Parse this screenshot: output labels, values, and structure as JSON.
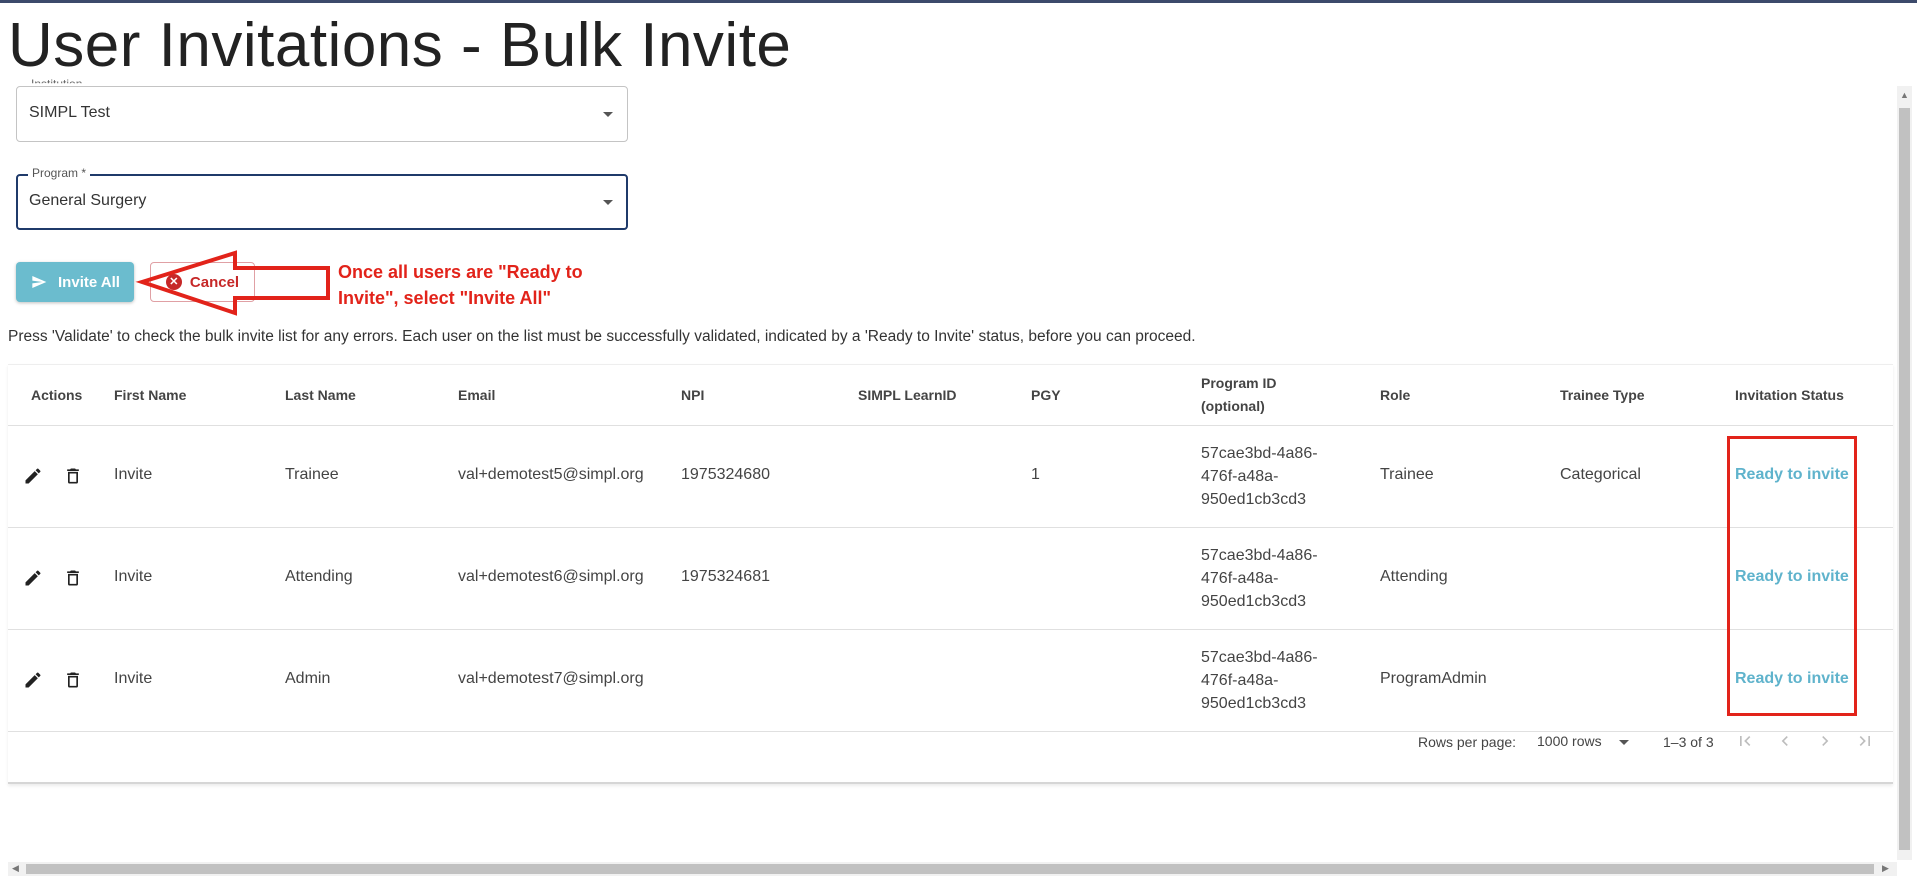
{
  "page": {
    "title": "User Invitations - Bulk Invite"
  },
  "form": {
    "institution": {
      "label": "Institution",
      "value": "SIMPL Test"
    },
    "program": {
      "label": "Program *",
      "value": "General Surgery"
    }
  },
  "buttons": {
    "invite_all": "Invite All",
    "cancel": "Cancel"
  },
  "annotation": {
    "text": "Once all users are \"Ready to Invite\", select \"Invite All\"",
    "color": "#e2231a"
  },
  "hint": "Press 'Validate' to check the bulk invite list for any errors. Each user on the list must be successfully validated, indicated by a 'Ready to Invite' status, before you can proceed.",
  "table": {
    "columns": {
      "actions": "Actions",
      "first_name": "First Name",
      "last_name": "Last Name",
      "email": "Email",
      "npi": "NPI",
      "learn_id": "SIMPL LearnID",
      "pgy": "PGY",
      "program_id_1": "Program ID",
      "program_id_2": "(optional)",
      "role": "Role",
      "trainee_type": "Trainee Type",
      "status": "Invitation Status"
    },
    "rows": [
      {
        "first": "Invite",
        "last": "Trainee",
        "email": "val+demotest5@simpl.org",
        "npi": "1975324680",
        "learn_id": "",
        "pgy": "1",
        "pid1": "57cae3bd-4a86-",
        "pid2": "476f-a48a-",
        "pid3": "950ed1cb3cd3",
        "role": "Trainee",
        "trainee_type": "Categorical",
        "status": "Ready to invite"
      },
      {
        "first": "Invite",
        "last": "Attending",
        "email": "val+demotest6@simpl.org",
        "npi": "1975324681",
        "learn_id": "",
        "pgy": "",
        "pid1": "57cae3bd-4a86-",
        "pid2": "476f-a48a-",
        "pid3": "950ed1cb3cd3",
        "role": "Attending",
        "trainee_type": "",
        "status": "Ready to invite"
      },
      {
        "first": "Invite",
        "last": "Admin",
        "email": "val+demotest7@simpl.org",
        "npi": "",
        "learn_id": "",
        "pgy": "",
        "pid1": "57cae3bd-4a86-",
        "pid2": "476f-a48a-",
        "pid3": "950ed1cb3cd3",
        "role": "ProgramAdmin",
        "trainee_type": "",
        "status": "Ready to invite"
      }
    ]
  },
  "pagination": {
    "rows_per_page_label": "Rows per page:",
    "rows_per_page_value": "1000 rows",
    "range": "1–3 of 3"
  },
  "icons": {
    "edit": "pencil-icon",
    "delete": "trash-icon",
    "send": "send-icon",
    "cancel": "close-circle-icon",
    "dropdown": "chevron-down-icon",
    "first_page": "first-page-icon",
    "prev_page": "chevron-left-icon",
    "next_page": "chevron-right-icon",
    "last_page": "last-page-icon"
  },
  "colors": {
    "primary_button": "#6bbcce",
    "cancel": "#c62828",
    "status_link": "#5fb3cc",
    "focused_border": "#1f3a6a",
    "annotation": "#e2231a"
  }
}
